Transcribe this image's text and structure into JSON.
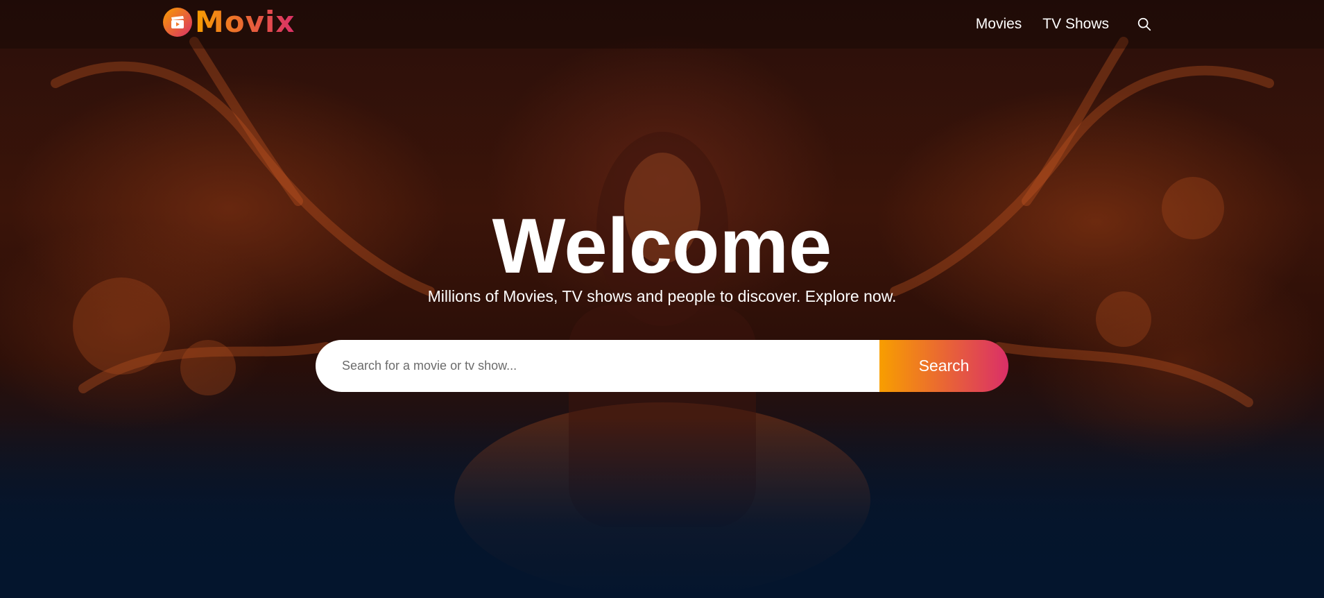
{
  "header": {
    "logo_text": "Movix",
    "nav": [
      {
        "label": "Movies"
      },
      {
        "label": "TV Shows"
      }
    ],
    "search_icon": "search-icon"
  },
  "hero": {
    "title": "Welcome",
    "subtitle": "Millions of Movies, TV shows and people to discover. Explore now.",
    "search": {
      "placeholder": "Search for a movie or tv show...",
      "value": "",
      "button_label": "Search"
    }
  },
  "colors": {
    "accent_start": "#f89e00",
    "accent_end": "#da2f68",
    "page_background": "#04152d"
  }
}
